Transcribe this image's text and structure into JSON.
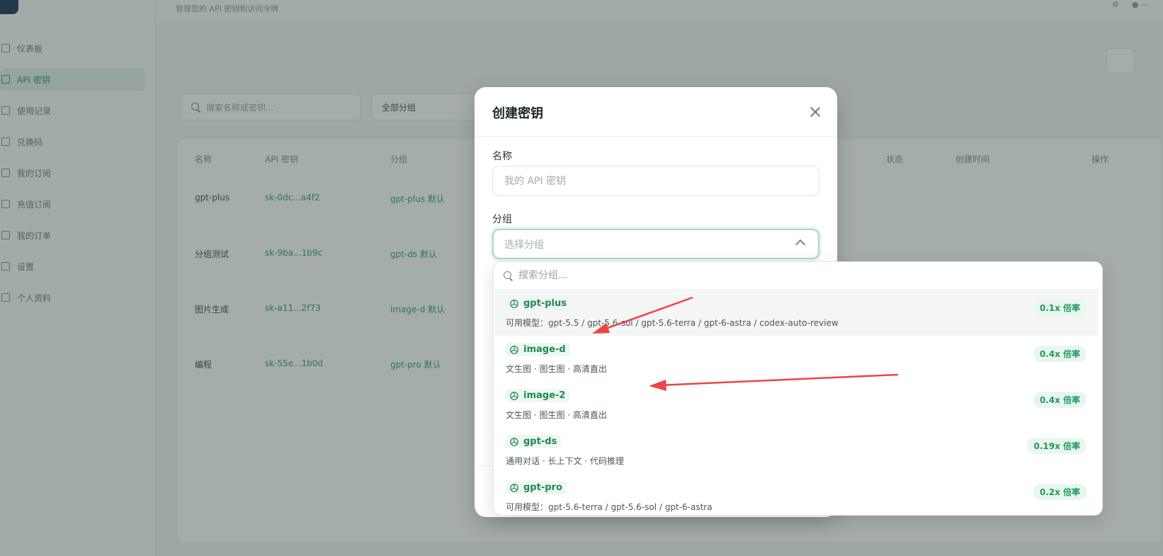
{
  "modal": {
    "title": "创建密钥",
    "name_label": "名称",
    "name_placeholder": "我的 API 密钥",
    "group_label": "分组",
    "group_placeholder": "选择分组"
  },
  "dropdown": {
    "search_placeholder": "搜索分组...",
    "options": [
      {
        "name": "gpt-plus",
        "desc": "可用模型：gpt-5.5 / gpt-5.6-sol / gpt-5.6-terra / gpt-6-astra / codex-auto-review",
        "rate": "0.1x 倍率"
      },
      {
        "name": "image-d",
        "desc": "文生图 · 图生图 · 高清直出",
        "rate": "0.4x 倍率"
      },
      {
        "name": "image-2",
        "desc": "文生图 · 图生图 · 高清直出",
        "rate": "0.4x 倍率"
      },
      {
        "name": "gpt-ds",
        "desc": "通用对话 · 长上下文 · 代码推理",
        "rate": "0.19x 倍率"
      },
      {
        "name": "gpt-pro",
        "desc": "可用模型：gpt-5.6-terra / gpt-5.6-sol / gpt-6-astra",
        "rate": "0.2x 倍率"
      }
    ]
  },
  "background": {
    "sidebar_items": [
      "仪表板",
      "API 密钥",
      "使用记录",
      "兑换码",
      "我的订阅",
      "充值订阅",
      "我的订单",
      "设置",
      "个人资料"
    ],
    "search_placeholder": "搜索名称或密钥...",
    "group_filter": "全部分组",
    "table_headers": [
      "名称",
      "API 密钥",
      "分组",
      "状态",
      "创建时间",
      "操作"
    ],
    "rows": [
      {
        "name": "gpt-plus",
        "key": "sk-0dc...a4f2",
        "group": "gpt-plus 默认"
      },
      {
        "name": "分组测试",
        "key": "sk-9ba...1b9c",
        "group": "gpt-ds 默认"
      },
      {
        "name": "图片生成",
        "key": "sk-a11...2f73",
        "group": "image-d 默认"
      },
      {
        "name": "编程",
        "key": "sk-55e...1b0d",
        "group": "gpt-pro 默认"
      }
    ]
  },
  "colors": {
    "accent": "#1f9a5c",
    "annotation_arrow": "#ef4444"
  }
}
